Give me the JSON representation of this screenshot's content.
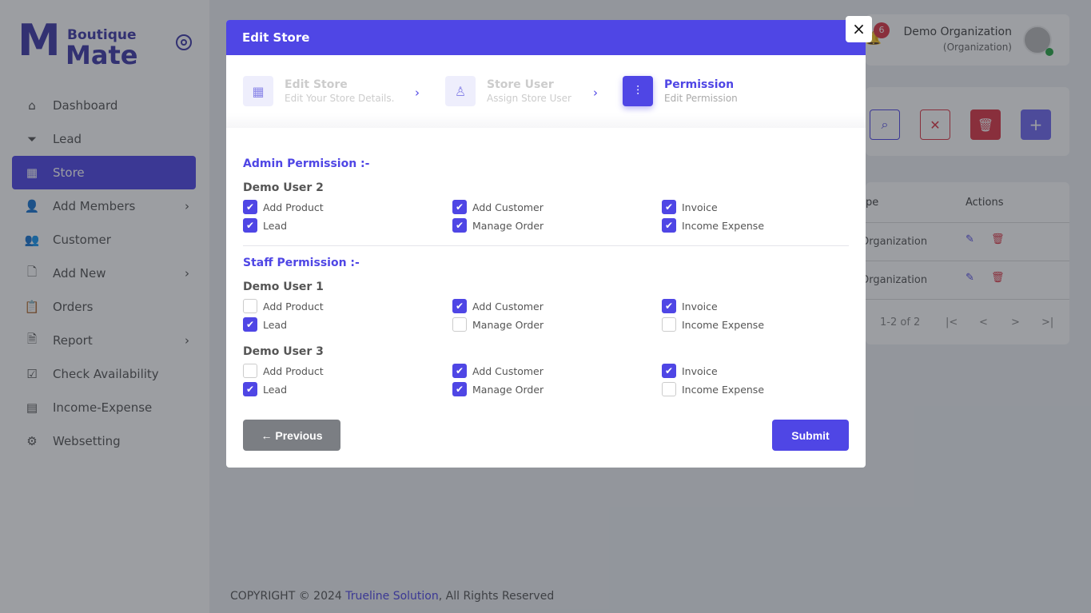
{
  "brand": {
    "line1": "Boutique",
    "line2": "Mate"
  },
  "sidebar": {
    "items": [
      {
        "label": "Dashboard",
        "icon": "home-icon"
      },
      {
        "label": "Lead",
        "icon": "filter-icon"
      },
      {
        "label": "Store",
        "icon": "grid-icon",
        "active": true
      },
      {
        "label": "Add Members",
        "icon": "user-plus-icon",
        "chevron": true
      },
      {
        "label": "Customer",
        "icon": "users-icon"
      },
      {
        "label": "Add New",
        "icon": "file-plus-icon",
        "chevron": true
      },
      {
        "label": "Orders",
        "icon": "clipboard-icon"
      },
      {
        "label": "Report",
        "icon": "file-text-icon",
        "chevron": true
      },
      {
        "label": "Check Availability",
        "icon": "check-square-icon"
      },
      {
        "label": "Income-Expense",
        "icon": "layout-icon"
      },
      {
        "label": "Websetting",
        "icon": "gear-icon"
      }
    ]
  },
  "header": {
    "notification_count": "6",
    "org_name": "Demo Organization",
    "org_role": "(Organization)"
  },
  "table": {
    "col_type": "pe",
    "col_actions": "Actions",
    "rows": [
      {
        "type": "Organization"
      },
      {
        "type": "Organization"
      }
    ],
    "pagination": "1-2 of 2"
  },
  "footer": {
    "prefix": "COPYRIGHT © 2024 ",
    "link": "Trueline Solution",
    "suffix": ", All Rights Reserved"
  },
  "modal": {
    "title": "Edit Store",
    "close": "×",
    "steps": [
      {
        "title": "Edit Store",
        "subtitle": "Edit Your Store Details."
      },
      {
        "title": "Store User",
        "subtitle": "Assign Store User"
      },
      {
        "title": "Permission",
        "subtitle": "Edit Permission",
        "active": true
      }
    ],
    "sections": [
      {
        "title": "Admin Permission :-",
        "users": [
          {
            "name": "Demo User 2",
            "perms": [
              [
                "Add Product",
                true
              ],
              [
                "Add Customer",
                true
              ],
              [
                "Invoice",
                true
              ],
              [
                "Lead",
                true
              ],
              [
                "Manage Order",
                true
              ],
              [
                "Income Expense",
                true
              ]
            ]
          }
        ]
      },
      {
        "title": "Staff Permission :-",
        "users": [
          {
            "name": "Demo User 1",
            "perms": [
              [
                "Add Product",
                false
              ],
              [
                "Add Customer",
                true
              ],
              [
                "Invoice",
                true
              ],
              [
                "Lead",
                true
              ],
              [
                "Manage Order",
                false
              ],
              [
                "Income Expense",
                false
              ]
            ]
          },
          {
            "name": "Demo User 3",
            "perms": [
              [
                "Add Product",
                false
              ],
              [
                "Add Customer",
                true
              ],
              [
                "Invoice",
                true
              ],
              [
                "Lead",
                true
              ],
              [
                "Manage Order",
                true
              ],
              [
                "Income Expense",
                false
              ]
            ]
          }
        ]
      }
    ],
    "previous": "← Previous",
    "submit": "Submit"
  },
  "colors": {
    "primary": "#4f46e5",
    "danger": "#dc3545",
    "online": "#28a745"
  }
}
